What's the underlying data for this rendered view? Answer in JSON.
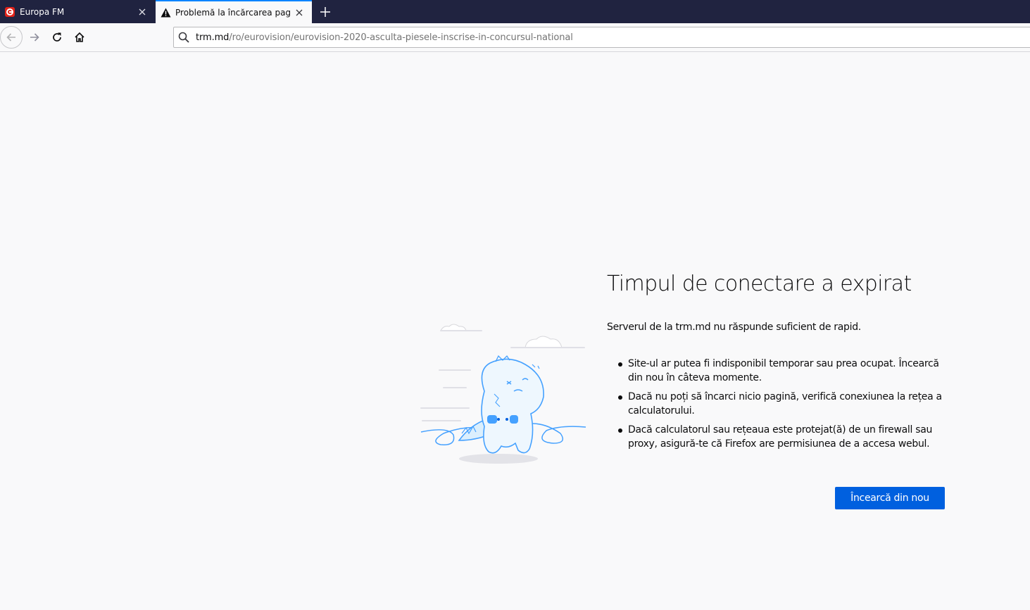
{
  "tabs": [
    {
      "title": "Europa FM",
      "icon": "europa-fm-logo",
      "active": false
    },
    {
      "title": "Problemă la încărcarea paginii",
      "icon": "warning-icon",
      "active": true
    }
  ],
  "urlbar": {
    "host": "trm.md",
    "path": "/ro/eurovision/eurovision-2020-asculta-piesele-inscrise-in-concursul-national"
  },
  "error": {
    "title": "Timpul de conectare a expirat",
    "description": "Serverul de la trm.md nu răspunde suficient de rapid.",
    "bullets": [
      "Site-ul ar putea fi indisponibil temporar sau prea ocupat. Încearcă din nou în câteva momente.",
      "Dacă nu poți să încarci nicio pagină, verifică conexiunea la rețea a calculatorului.",
      "Dacă calculatorul sau rețeaua este protejat(ă) de un firewall sau proxy, asigură-te că Firefox are permisiunea de a accesa webul."
    ],
    "retry_label": "Încearcă din nou"
  },
  "colors": {
    "tabstrip": "#202340",
    "accent": "#0060df",
    "page_bg": "#f9f9fa"
  }
}
